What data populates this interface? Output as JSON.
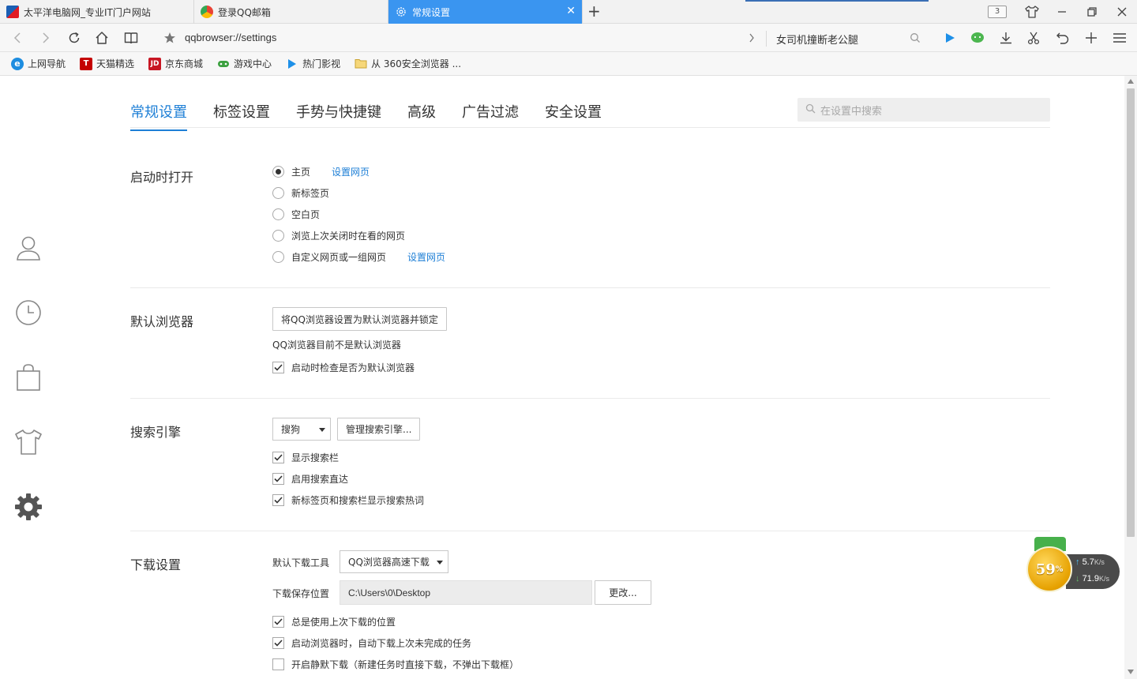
{
  "tabs": [
    {
      "title": "太平洋电脑网_专业IT门户网站",
      "active": false
    },
    {
      "title": "登录QQ邮箱",
      "active": false
    },
    {
      "title": "常规设置",
      "active": true
    }
  ],
  "tab_count": "3",
  "address": {
    "url": "qqbrowser://settings",
    "search_text": "女司机撞断老公腿"
  },
  "bookmarks": [
    {
      "label": "上网导航",
      "icon": "ie-icon"
    },
    {
      "label": "天猫精选",
      "icon": "tmall-icon"
    },
    {
      "label": "京东商城",
      "icon": "jd-icon"
    },
    {
      "label": "游戏中心",
      "icon": "gamepad-icon"
    },
    {
      "label": "热门影视",
      "icon": "video-icon"
    },
    {
      "label": "从 360安全浏览器 ...",
      "icon": "folder-icon"
    }
  ],
  "settings_tabs": [
    "常规设置",
    "标签设置",
    "手势与快捷键",
    "高级",
    "广告过滤",
    "安全设置"
  ],
  "settings_search_placeholder": "在设置中搜索",
  "startup": {
    "title": "启动时打开",
    "options": [
      {
        "label": "主页",
        "selected": true,
        "link": "设置网页"
      },
      {
        "label": "新标签页",
        "selected": false
      },
      {
        "label": "空白页",
        "selected": false
      },
      {
        "label": "浏览上次关闭时在看的网页",
        "selected": false
      },
      {
        "label": "自定义网页或一组网页",
        "selected": false,
        "link": "设置网页"
      }
    ]
  },
  "default_browser": {
    "title": "默认浏览器",
    "button": "将QQ浏览器设置为默认浏览器并锁定",
    "status": "QQ浏览器目前不是默认浏览器",
    "check_label": "启动时检查是否为默认浏览器",
    "check_on": true
  },
  "search_engine": {
    "title": "搜索引擎",
    "selected": "搜狗",
    "manage_button": "管理搜索引擎...",
    "checks": [
      {
        "label": "显示搜索栏",
        "on": true
      },
      {
        "label": "启用搜索直达",
        "on": true
      },
      {
        "label": "新标签页和搜索栏显示搜索热词",
        "on": true
      }
    ]
  },
  "download": {
    "title": "下载设置",
    "tool_label": "默认下载工具",
    "tool_selected": "QQ浏览器高速下载",
    "path_label": "下载保存位置",
    "path": "C:\\Users\\0\\Desktop",
    "change_button": "更改...",
    "checks": [
      {
        "label": "总是使用上次下载的位置",
        "on": true
      },
      {
        "label": "启动浏览器时，自动下载上次未完成的任务",
        "on": true
      },
      {
        "label": "开启静默下载（新建任务时直接下载，不弹出下载框）",
        "on": false
      }
    ]
  },
  "net_widget": {
    "percent": "59",
    "percent_sign": "%",
    "up_speed": "5.7",
    "down_speed": "71.9",
    "unit": "K/s"
  },
  "colors": {
    "accent": "#1e7fd6",
    "active_tab": "#3a95f0"
  }
}
